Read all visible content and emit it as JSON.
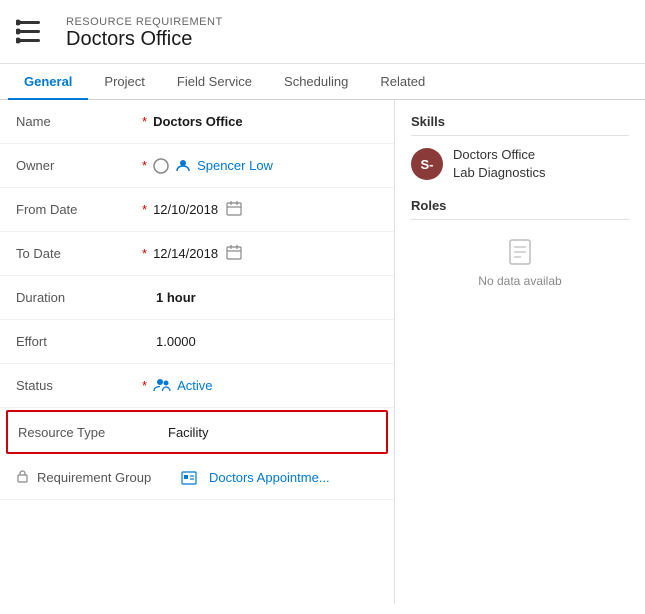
{
  "header": {
    "subtitle": "RESOURCE REQUIREMENT",
    "title": "Doctors Office"
  },
  "nav": {
    "tabs": [
      {
        "label": "General",
        "active": true
      },
      {
        "label": "Project",
        "active": false
      },
      {
        "label": "Field Service",
        "active": false
      },
      {
        "label": "Scheduling",
        "active": false
      },
      {
        "label": "Related",
        "active": false
      }
    ]
  },
  "form": {
    "name_label": "Name",
    "name_value": "Doctors Office",
    "owner_label": "Owner",
    "owner_value": "Spencer Low",
    "from_date_label": "From Date",
    "from_date_value": "12/10/2018",
    "to_date_label": "To Date",
    "to_date_value": "12/14/2018",
    "duration_label": "Duration",
    "duration_value": "1 hour",
    "effort_label": "Effort",
    "effort_value": "1.0000",
    "status_label": "Status",
    "status_value": "Active",
    "resource_type_label": "Resource Type",
    "resource_type_value": "Facility",
    "req_group_label": "Requirement Group",
    "req_group_value": "Doctors Appointme..."
  },
  "right_panel": {
    "skills_title": "Skills",
    "skills_avatar_initials": "S-",
    "skills_item_text": "Doctors Office Lab Diagnostics",
    "roles_title": "Roles",
    "no_data_text": "No data availab"
  }
}
